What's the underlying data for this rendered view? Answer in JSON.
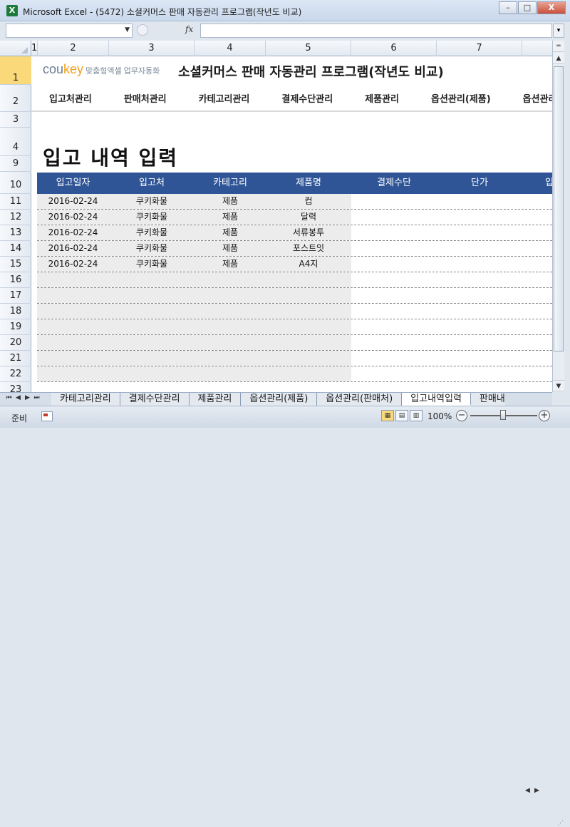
{
  "window": {
    "title": "Microsoft Excel - (5472) 소셜커머스 판매 자동관리 프로그램(작년도 비교)",
    "app_icon": "excel-icon",
    "minimize": "–",
    "restore": "□",
    "close": "X"
  },
  "formula_bar": {
    "namebox_value": "",
    "fx_label": "fx",
    "formula_value": ""
  },
  "columns": [
    "1",
    "2",
    "3",
    "4",
    "5",
    "6",
    "7"
  ],
  "rows": [
    "1",
    "2",
    "3",
    "4",
    "9",
    "10",
    "11",
    "12",
    "13",
    "14",
    "15",
    "16",
    "17",
    "18",
    "19",
    "20",
    "21",
    "22",
    "23"
  ],
  "header": {
    "logo_co": "cou",
    "logo_key": "key",
    "logo_tag": "맞춤형엑셀 업무자동화",
    "title": "소셜커머스 판매 자동관리 프로그램(작년도 비교)"
  },
  "nav": {
    "items": [
      "입고처관리",
      "판매처관리",
      "카테고리관리",
      "결제수단관리",
      "제품관리",
      "옵션관리(제품)",
      "옵션관리(판매처)"
    ]
  },
  "page": {
    "heading": "입고 내역 입력"
  },
  "table": {
    "headers": [
      "입고일자",
      "입고처",
      "카테고리",
      "제품명",
      "결제수단",
      "단가",
      "입"
    ],
    "rows": [
      [
        "2016-02-24",
        "쿠키화물",
        "제품",
        "컵",
        "",
        ""
      ],
      [
        "2016-02-24",
        "쿠키화물",
        "제품",
        "달력",
        "",
        ""
      ],
      [
        "2016-02-24",
        "쿠키화물",
        "제품",
        "서류봉투",
        "",
        ""
      ],
      [
        "2016-02-24",
        "쿠키화물",
        "제품",
        "포스트잇",
        "",
        ""
      ],
      [
        "2016-02-24",
        "쿠키화물",
        "제품",
        "A4지",
        "",
        ""
      ],
      [
        "",
        "",
        "",
        "",
        "",
        ""
      ],
      [
        "",
        "",
        "",
        "",
        "",
        ""
      ],
      [
        "",
        "",
        "",
        "",
        "",
        ""
      ],
      [
        "",
        "",
        "",
        "",
        "",
        ""
      ],
      [
        "",
        "",
        "",
        "",
        "",
        ""
      ],
      [
        "",
        "",
        "",
        "",
        "",
        ""
      ],
      [
        "",
        "",
        "",
        "",
        "",
        ""
      ]
    ]
  },
  "sheet_tabs": {
    "tabs": [
      "카테고리관리",
      "결제수단관리",
      "제품관리",
      "옵션관리(제품)",
      "옵션관리(판매처)",
      "입고내역입력",
      "판매내"
    ],
    "active_index": 5
  },
  "status": {
    "ready": "준비",
    "zoom": "100%",
    "zoom_minus": "−",
    "zoom_plus": "+"
  },
  "colors": {
    "table_header": "#2f5597",
    "row_selected": "#f9d97a",
    "logo_key": "#f0a21a"
  }
}
